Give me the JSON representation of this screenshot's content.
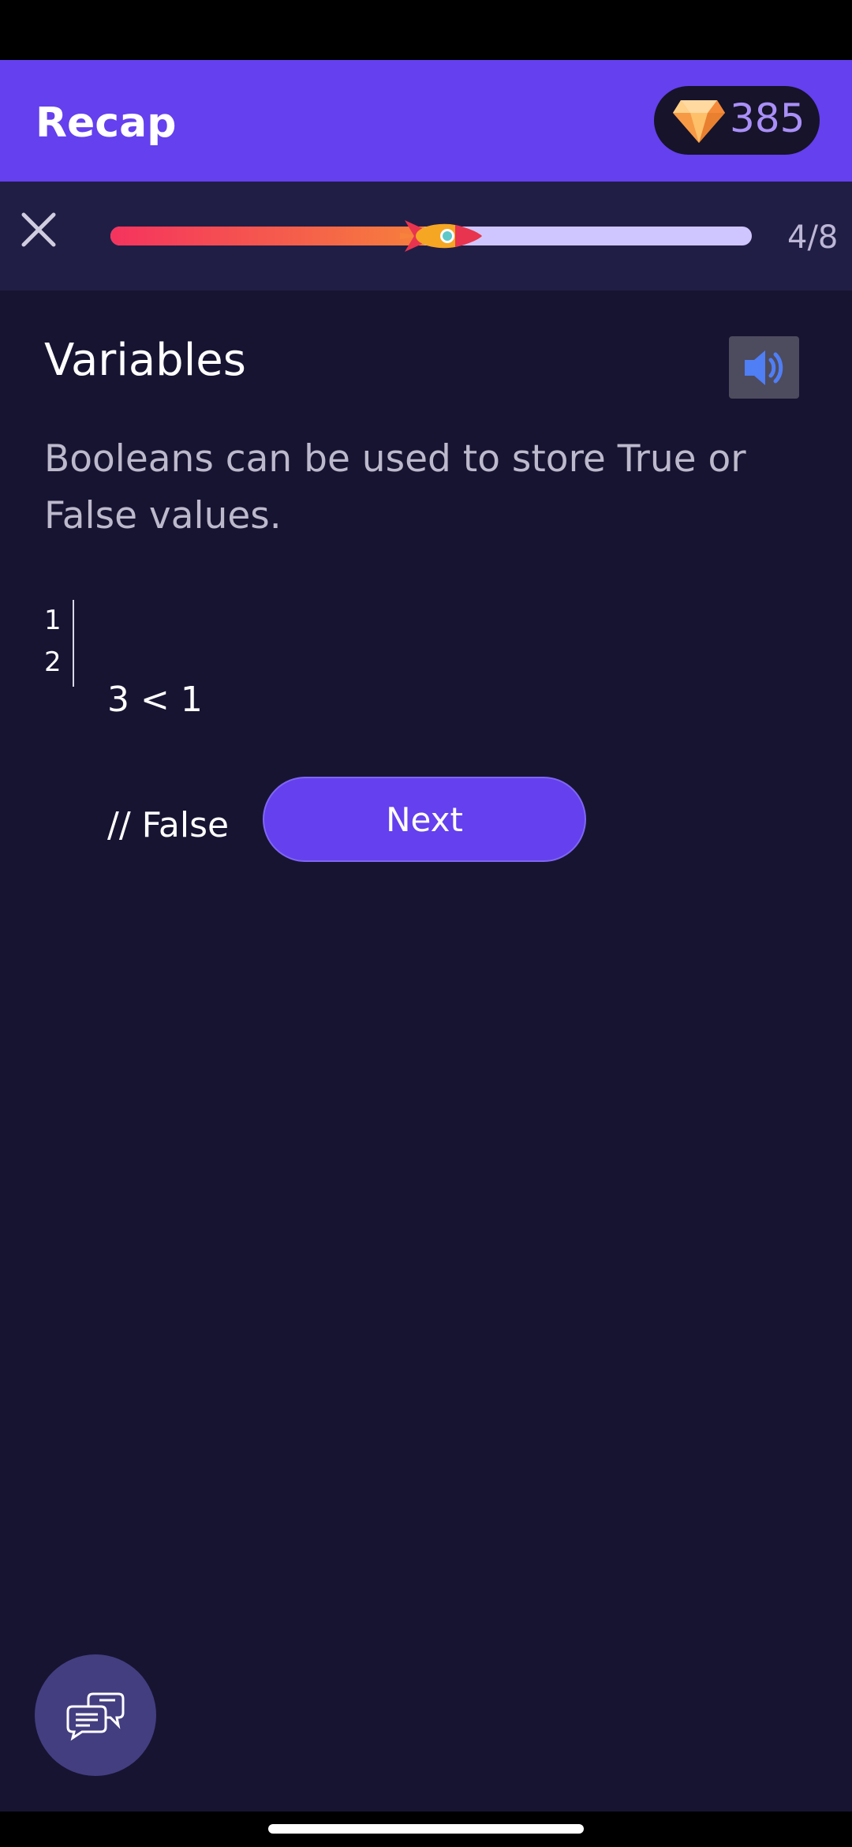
{
  "header": {
    "title": "Recap",
    "gems": "385"
  },
  "progress": {
    "current": 4,
    "total": 8,
    "fraction": 0.5,
    "label": "4/8"
  },
  "lesson": {
    "title": "Variables",
    "text": "Booleans can be used to store True or False values.",
    "code": {
      "line_numbers": [
        "1",
        "2"
      ],
      "lines": [
        "3 < 1",
        "// False"
      ]
    },
    "next_label": "Next"
  },
  "icons": {
    "gem": "gem-icon",
    "close": "close-icon",
    "rocket": "rocket-icon",
    "speaker": "speaker-icon",
    "chat": "chat-bubbles-icon"
  },
  "colors": {
    "accent": "#6440ee",
    "background": "#171432",
    "progress_track": "#cfc6ff",
    "gem_text": "#a98ff7"
  }
}
